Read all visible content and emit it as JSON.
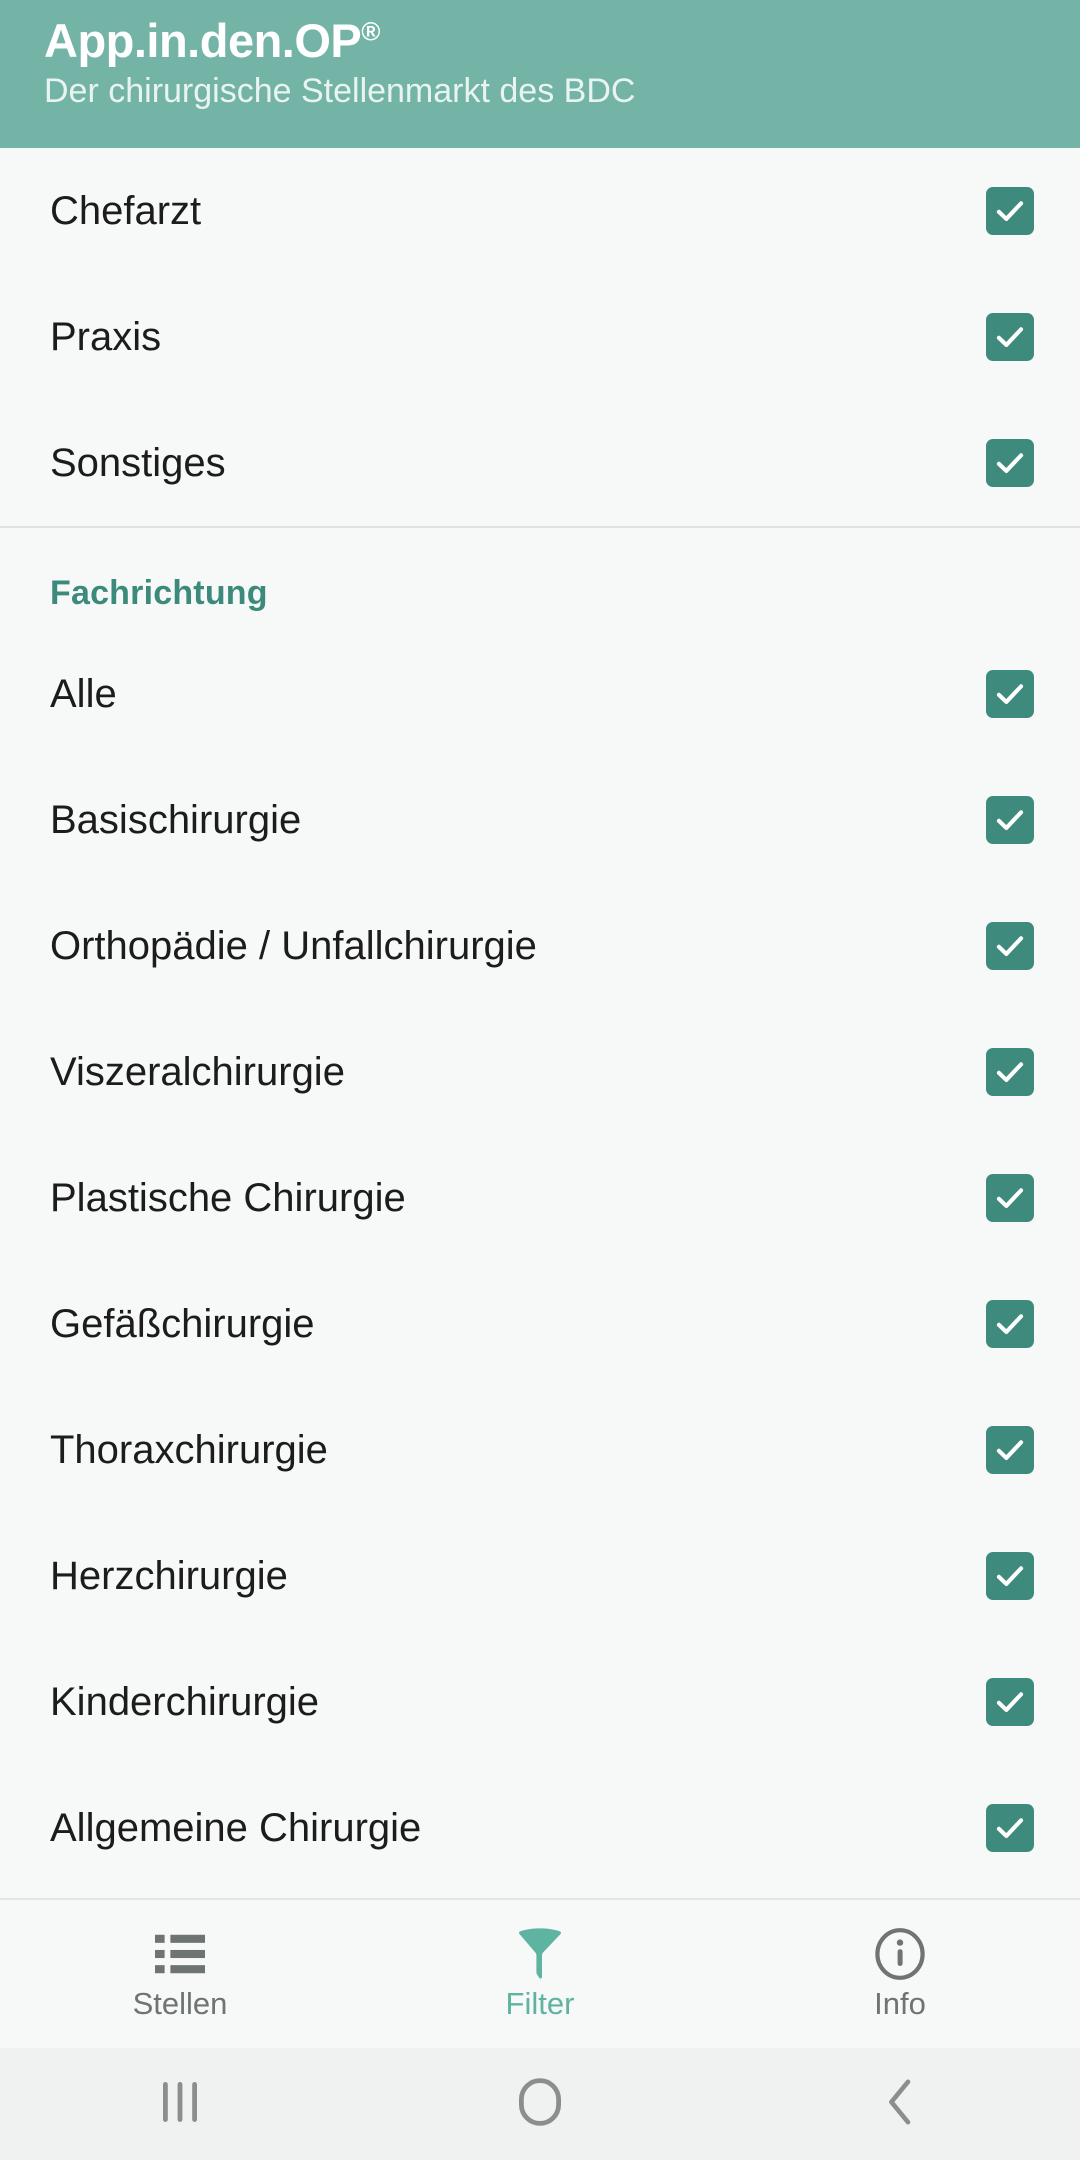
{
  "header": {
    "title": "App.in.den.OP",
    "trademark": "®",
    "subtitle": "Der chirurgische Stellenmarkt des BDC",
    "bg_color": "#73b4a6"
  },
  "colors": {
    "accent_teal": "#3e8b7d",
    "header_teal": "#73b4a6",
    "tab_active": "#5fb3a1",
    "page_bg": "#f7f8f8",
    "divider": "#dfe2e1"
  },
  "list": {
    "top_group": [
      {
        "label": "Chefarzt",
        "checked": true
      },
      {
        "label": "Praxis",
        "checked": true
      },
      {
        "label": "Sonstiges",
        "checked": true
      }
    ],
    "section_title": "Fachrichtung",
    "fachrichtung": [
      {
        "label": "Alle",
        "checked": true
      },
      {
        "label": "Basischirurgie",
        "checked": true
      },
      {
        "label": "Orthopädie / Unfallchirurgie",
        "checked": true
      },
      {
        "label": "Viszeralchirurgie",
        "checked": true
      },
      {
        "label": "Plastische Chirurgie",
        "checked": true
      },
      {
        "label": "Gefäßchirurgie",
        "checked": true
      },
      {
        "label": "Thoraxchirurgie",
        "checked": true
      },
      {
        "label": "Herzchirurgie",
        "checked": true
      },
      {
        "label": "Kinderchirurgie",
        "checked": true
      },
      {
        "label": "Allgemeine Chirurgie",
        "checked": true
      }
    ]
  },
  "tabbar": {
    "tabs": [
      {
        "label": "Stellen",
        "icon": "list-icon",
        "active": false
      },
      {
        "label": "Filter",
        "icon": "funnel-icon",
        "active": true
      },
      {
        "label": "Info",
        "icon": "info-circle-icon",
        "active": false
      }
    ]
  },
  "system_nav": {
    "recents": "recents-icon",
    "home": "home-icon",
    "back": "back-icon"
  }
}
